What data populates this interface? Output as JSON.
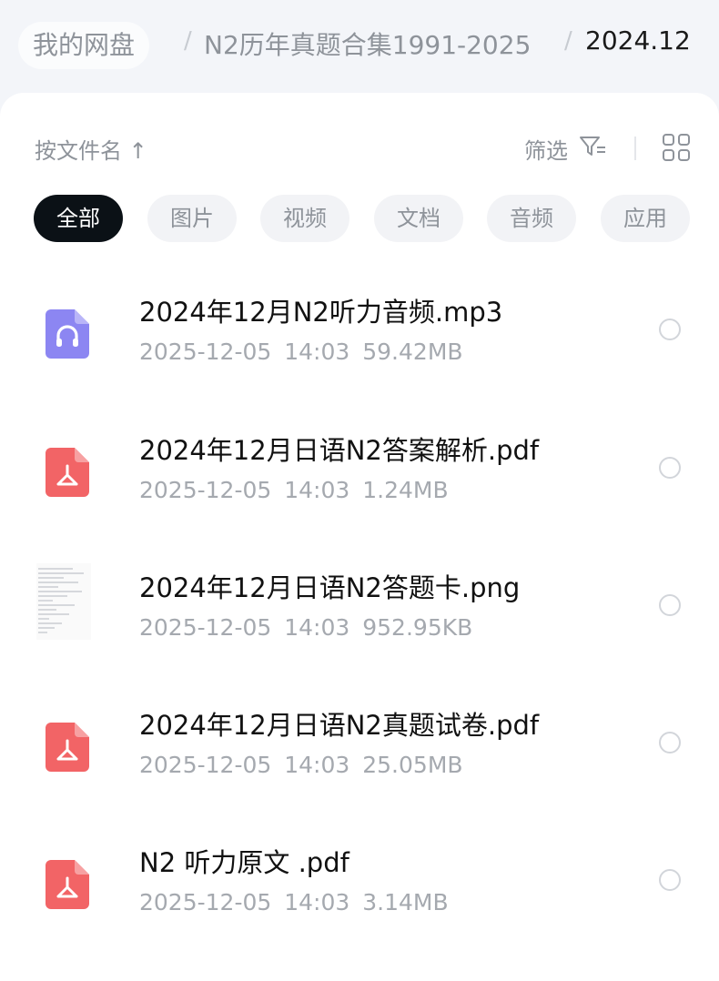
{
  "breadcrumb": {
    "root": "我的网盘",
    "separator": "/",
    "middle": "N2历年真题合集1991-2025",
    "current": "2024.12"
  },
  "toolbar": {
    "sort_label": "按文件名 ↑",
    "filter_label": "筛选",
    "filter_icon": "filter-icon",
    "view_icon": "grid-view-icon"
  },
  "chips": [
    "全部",
    "图片",
    "视频",
    "文档",
    "音频",
    "应用"
  ],
  "active_chip": "全部",
  "files": [
    {
      "name": "2024年12月N2听力音频.mp3",
      "date": "2025-12-05",
      "time": "14:03",
      "size": "59.42MB",
      "icon": "audio-file-icon"
    },
    {
      "name": "2024年12月日语N2答案解析.pdf",
      "date": "2025-12-05",
      "time": "14:03",
      "size": "1.24MB",
      "icon": "pdf-file-icon"
    },
    {
      "name": "2024年12月日语N2答题卡.png",
      "date": "2025-12-05",
      "time": "14:03",
      "size": "952.95KB",
      "icon": "image-thumbnail-icon"
    },
    {
      "name": "2024年12月日语N2真题试卷.pdf",
      "date": "2025-12-05",
      "time": "14:03",
      "size": "25.05MB",
      "icon": "pdf-file-icon"
    },
    {
      "name": "N2 听力原文 .pdf",
      "date": "2025-12-05",
      "time": "14:03",
      "size": "3.14MB",
      "icon": "pdf-file-icon"
    }
  ],
  "colors": {
    "audio_icon": "#8c86f2",
    "pdf_icon": "#f26466",
    "active_chip_bg": "#0b1116",
    "muted_text": "#8e939a"
  }
}
